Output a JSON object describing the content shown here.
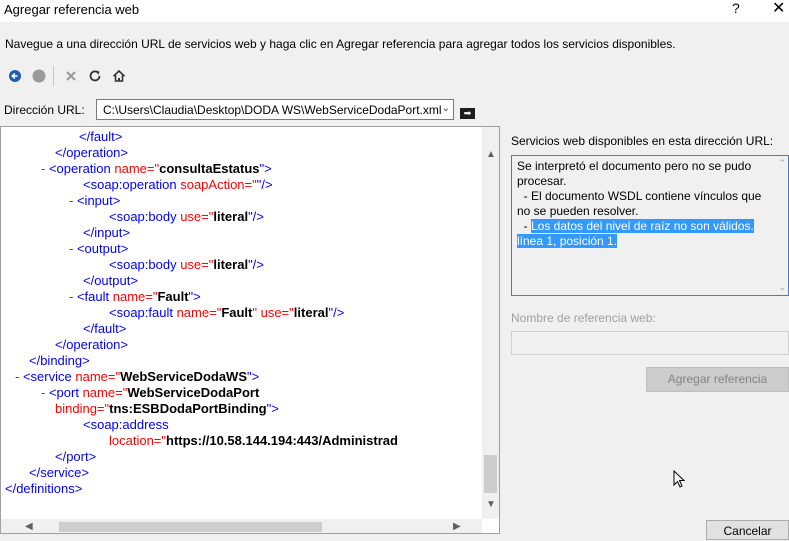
{
  "window": {
    "title": "Agregar referencia web",
    "help_label": "?",
    "close_label": "✕"
  },
  "instructions": "Navegue a una dirección URL de servicios web y haga clic en Agregar referencia para agregar todos los servicios disponibles.",
  "toolbar": {
    "icons": [
      "back-icon",
      "stop-icon",
      "close-icon",
      "refresh-icon",
      "home-icon"
    ]
  },
  "address": {
    "label": "Dirección URL:",
    "value": "C:\\Users\\Claudia\\Desktop\\DODA WS\\WebServiceDodaPort.xml"
  },
  "xml": {
    "l1_tag": "</fault>",
    "l2_tag": "</operation>",
    "l3_marker": "-",
    "l3_open": "<operation ",
    "l3_attr": "name=\"",
    "l3_value": "consultaEstatus",
    "l3_end": "\">",
    "l4_open": "<soap:operation ",
    "l4_attr": "soapAction=\"",
    "l4_value": "",
    "l4_end": "\"/>",
    "l5_marker": "-",
    "l5_tag": "<input>",
    "l6_open": "<soap:body ",
    "l6_attr": "use=\"",
    "l6_value": "literal",
    "l6_end": "\"/>",
    "l7_tag": "</input>",
    "l8_marker": "-",
    "l8_tag": "<output>",
    "l9_open": "<soap:body ",
    "l9_attr": "use=\"",
    "l9_value": "literal",
    "l9_end": "\"/>",
    "l10_tag": "</output>",
    "l11_marker": "-",
    "l11_open": "<fault ",
    "l11_attr": "name=\"",
    "l11_value": "Fault",
    "l11_end": "\">",
    "l12_open": "<soap:fault ",
    "l12_attr1": "name=\"",
    "l12_value1": "Fault",
    "l12_mid": "\" use=\"",
    "l12_value2": "literal",
    "l12_end": "\"/>",
    "l13_tag": "</fault>",
    "l14_tag": "</operation>",
    "l15_tag": "</binding>",
    "l16_marker": "-",
    "l16_open": "<service ",
    "l16_attr": "name=\"",
    "l16_value": "WebServiceDodaWS",
    "l16_end": "\">",
    "l17_marker": "-",
    "l17_open": "<port ",
    "l17_attr": "name=\"",
    "l17_value": "WebServiceDodaPort",
    "l18_attr": "binding=\"",
    "l18_value": "tns:ESBDodaPortBinding",
    "l18_end": "\">",
    "l19_tag": "<soap:address",
    "l20_attr": "location=\"",
    "l20_value": "https://10.58.144.194:443/Administrad",
    "l21_tag": "</port>",
    "l22_tag": "</service>",
    "l23_tag": "</definitions>"
  },
  "services": {
    "label": "Servicios web disponibles en esta dirección URL:",
    "line1": "Se interpretó el documento pero no se pudo",
    "line2": "procesar.",
    "line3": "  - El documento WSDL contiene vínculos que",
    "line4": "no se pueden resolver.",
    "line5_prefix": "  - ",
    "line5_hl": "Los datos del nivel de raíz no son válidos.",
    "line6_hl": "línea 1, posición 1."
  },
  "refname": {
    "label": "Nombre de referencia web:",
    "value": ""
  },
  "buttons": {
    "add": "Agregar referencia",
    "cancel": "Cancelar",
    "go": "➡"
  },
  "colors": {
    "selection": "#3399ff",
    "xml_tag": "#990000",
    "xml_bracket": "#0000ff",
    "xml_attr": "#ff0000",
    "xml_marker": "#ff0000"
  }
}
